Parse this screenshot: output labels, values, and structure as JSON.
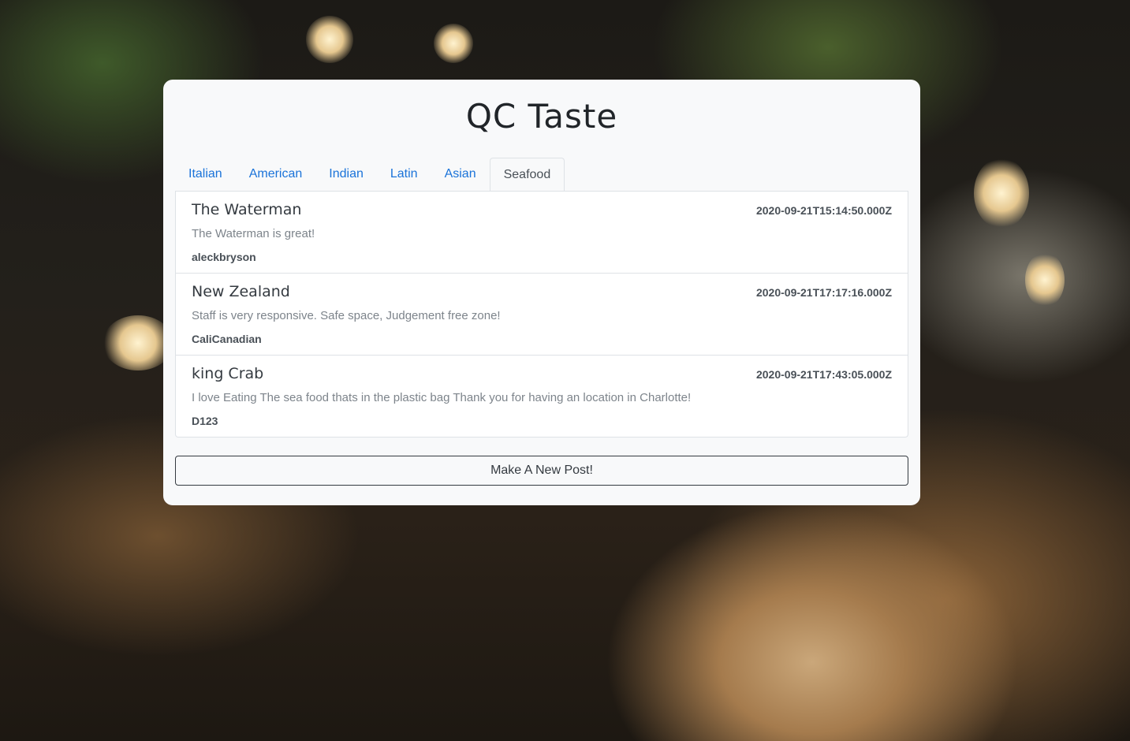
{
  "app": {
    "title": "QC Taste"
  },
  "tabs": [
    {
      "label": "Italian",
      "active": false
    },
    {
      "label": "American",
      "active": false
    },
    {
      "label": "Indian",
      "active": false
    },
    {
      "label": "Latin",
      "active": false
    },
    {
      "label": "Asian",
      "active": false
    },
    {
      "label": "Seafood",
      "active": true
    }
  ],
  "posts": [
    {
      "title": "The Waterman",
      "date": "2020-09-21T15:14:50.000Z",
      "body": "The Waterman is great!",
      "author": "aleckbryson"
    },
    {
      "title": "New Zealand",
      "date": "2020-09-21T17:17:16.000Z",
      "body": "Staff is very responsive. Safe space, Judgement free zone!",
      "author": "CaliCanadian"
    },
    {
      "title": "king Crab",
      "date": "2020-09-21T17:43:05.000Z",
      "body": "I love Eating The sea food thats in the plastic bag Thank you for having an location in Charlotte!",
      "author": "D123"
    }
  ],
  "actions": {
    "new_post_label": "Make A New Post!"
  },
  "colors": {
    "tab_link": "#1a73d9",
    "card_bg": "#f8f9fa",
    "text_dark": "#212529"
  }
}
